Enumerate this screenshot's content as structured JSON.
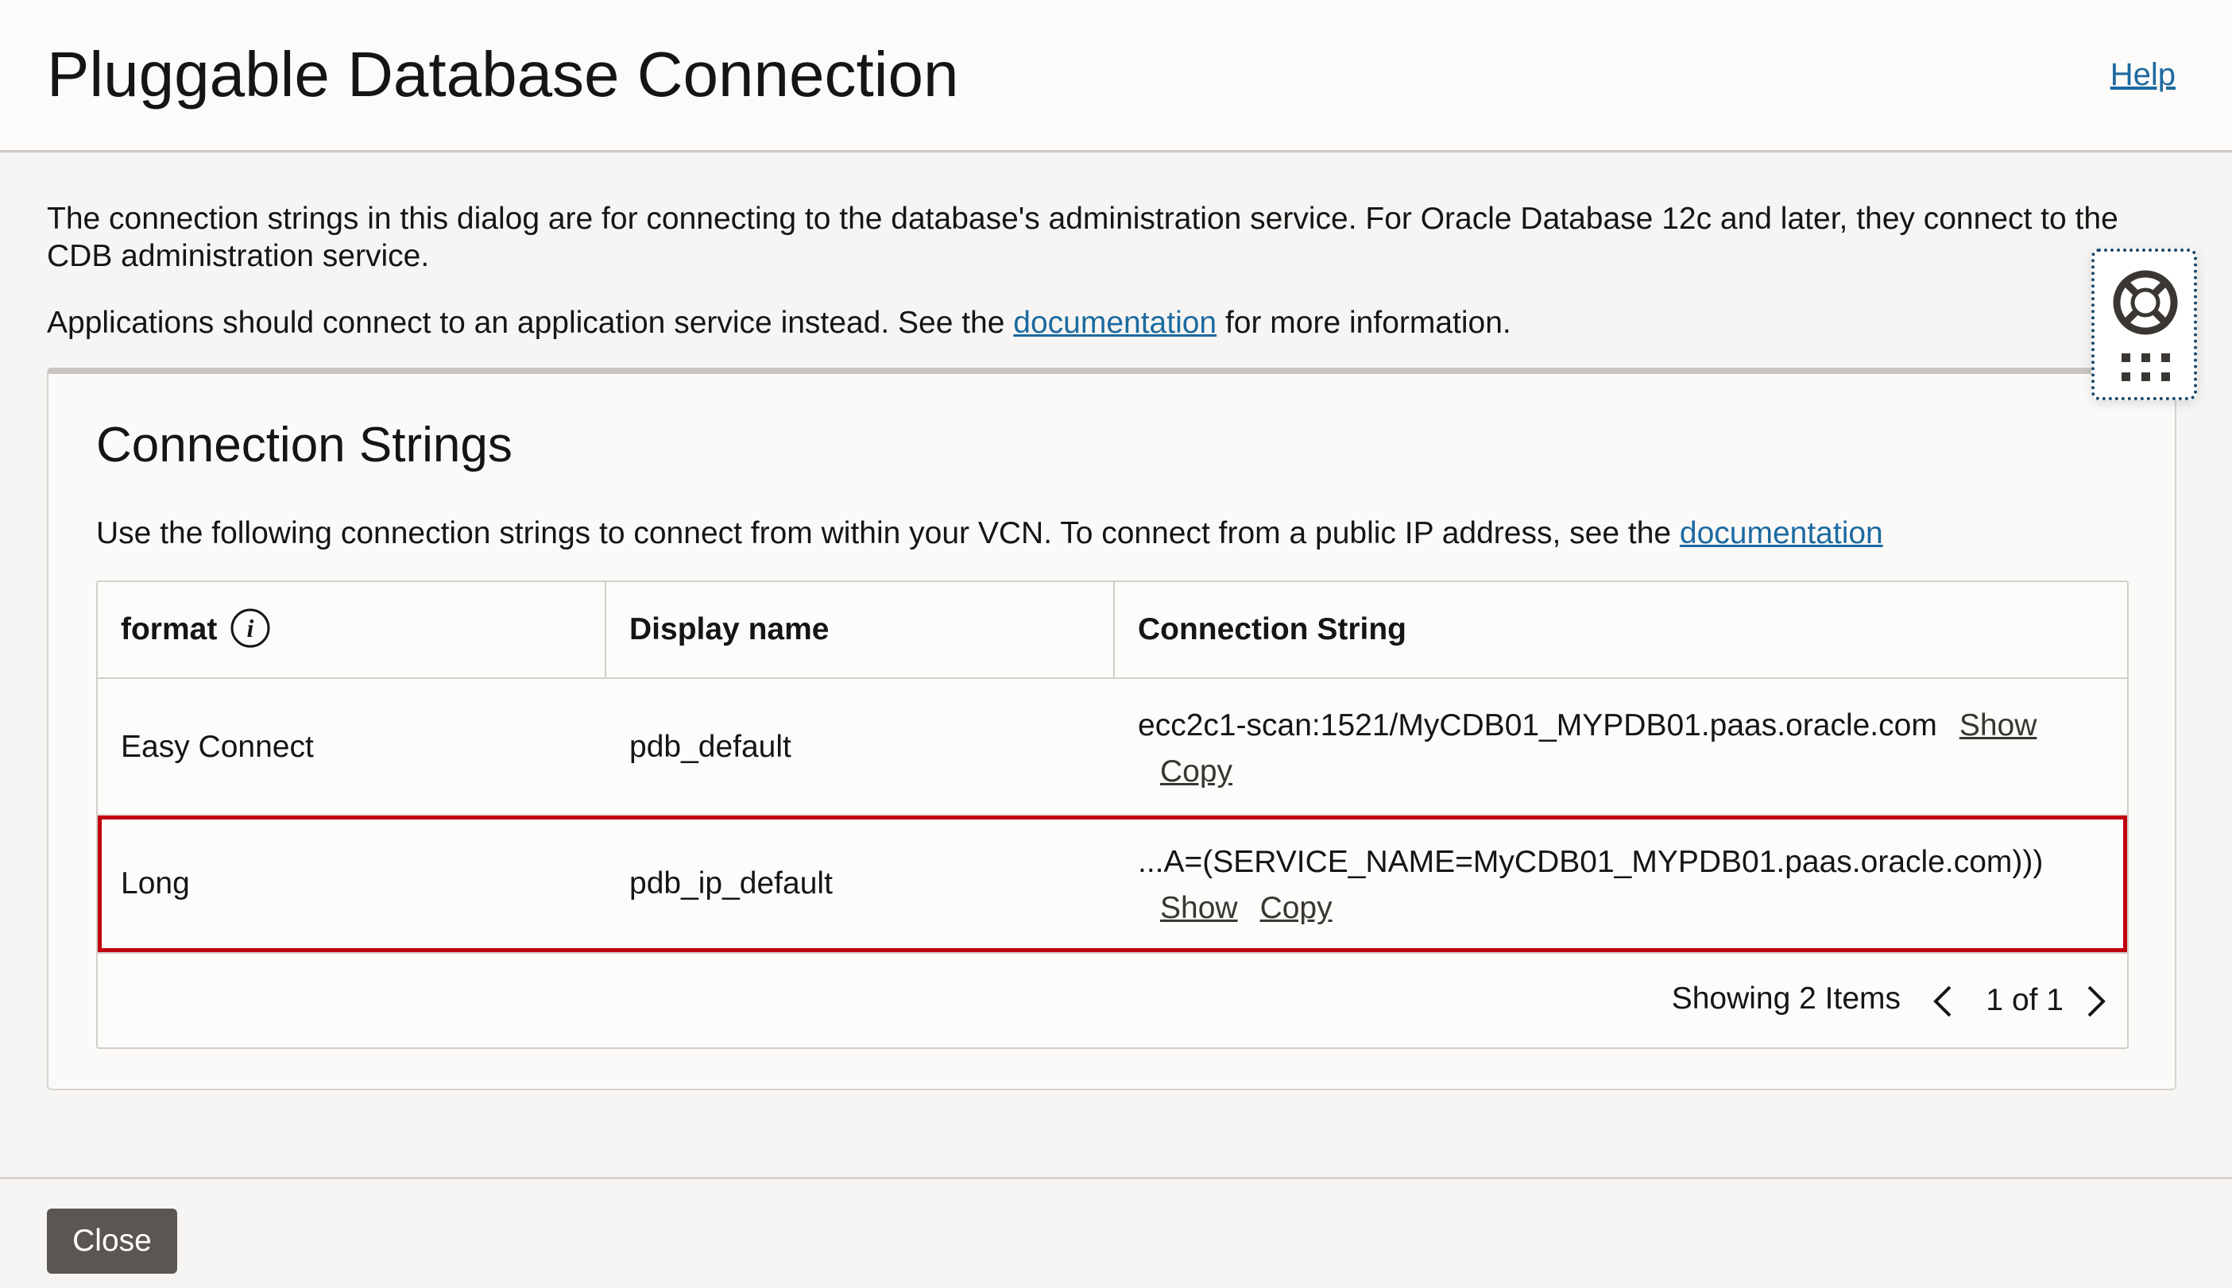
{
  "dialog": {
    "title": "Pluggable Database Connection",
    "help_label": "Help"
  },
  "intro": {
    "text": "The connection strings in this dialog are for connecting to the database's administration service. For Oracle Database 12c and later, they connect to the CDB administration service.",
    "apps_prefix": "Applications should connect to an application service instead. See the ",
    "apps_link": "documentation",
    "apps_suffix": " for more information."
  },
  "help_widget": {
    "icon": "lifebuoy-icon",
    "grid_icon": "apps-grid-icon"
  },
  "panel": {
    "title": "Connection Strings",
    "desc_prefix": "Use the following connection strings to connect from within your VCN. To connect from a public IP address, see the ",
    "desc_link": "documentation"
  },
  "table": {
    "columns": [
      "format",
      "Display name",
      "Connection String"
    ],
    "rows": [
      {
        "format": "Easy Connect",
        "display_name": "pdb_default",
        "connection_string": "ecc2c1-scan:1521/MyCDB01_MYPDB01.paas.oracle.com",
        "show_label": "Show",
        "copy_label": "Copy",
        "selected": false
      },
      {
        "format": "Long",
        "display_name": "pdb_ip_default",
        "connection_string": "...A=(SERVICE_NAME=MyCDB01_MYPDB01.paas.oracle.com)))",
        "show_label": "Show",
        "copy_label": "Copy",
        "selected": true
      }
    ],
    "showing": "Showing 2 Items",
    "pager": "1 of 1"
  },
  "footer": {
    "close_label": "Close"
  },
  "colors": {
    "link": "#1c6aa0",
    "selected_outline": "#c00010",
    "close_button": "#5b5652"
  }
}
